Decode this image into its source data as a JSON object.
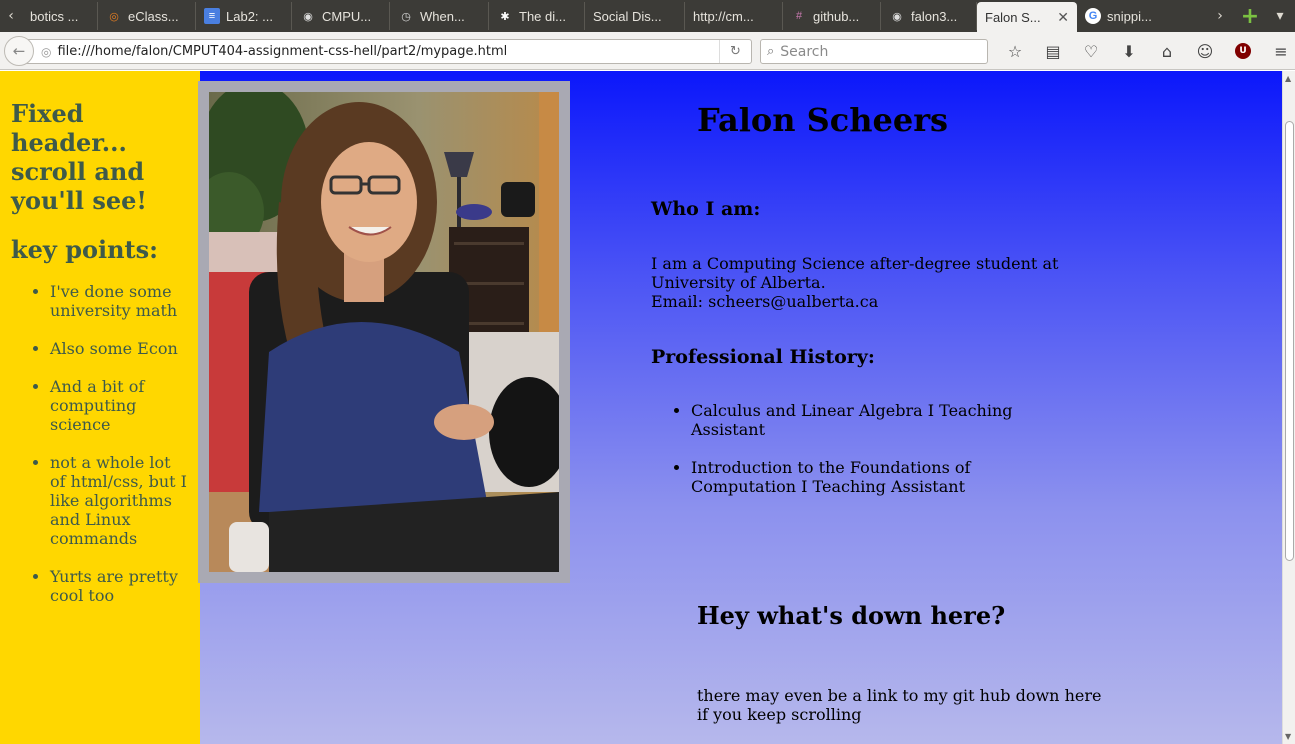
{
  "browser": {
    "tabs": [
      {
        "label": "botics ...",
        "icon": "doc-icon"
      },
      {
        "label": "eClass...",
        "icon": "eclass-icon"
      },
      {
        "label": "Lab2: ...",
        "icon": "google-docs-icon"
      },
      {
        "label": "CMPU...",
        "icon": "github-icon"
      },
      {
        "label": "When...",
        "icon": "clock-icon"
      },
      {
        "label": "The di...",
        "icon": "star-icon"
      },
      {
        "label": "Social Dis...",
        "icon": ""
      },
      {
        "label": "http://cm...",
        "icon": ""
      },
      {
        "label": "github...",
        "icon": "slack-icon"
      },
      {
        "label": "falon3...",
        "icon": "github-icon"
      },
      {
        "label": "Falon S...",
        "icon": "",
        "active": true
      },
      {
        "label": "snippi...",
        "icon": "google-icon"
      }
    ],
    "url": "file:///home/falon/CMPUT404-assignment-css-hell/part2/mypage.html",
    "search_placeholder": "Search",
    "ublock_badge": "U"
  },
  "sidebar": {
    "header": "Fixed header... scroll and you'll see!",
    "subheader": "key points:",
    "points": [
      "I've done some university math",
      "Also some Econ",
      "And a bit of computing science",
      "not a whole lot of html/css, but I like algorithms and Linux commands",
      "Yurts are pretty cool too"
    ]
  },
  "main": {
    "name": "Falon Scheers",
    "who_heading": "Who I am:",
    "who_line1": "I am a Computing Science after-degree student at University of Alberta.",
    "who_email": "Email: scheers@ualberta.ca",
    "prof_heading": "Professional History:",
    "prof_items": [
      "Calculus and Linear Algebra I Teaching Assistant",
      "Introduction to the Foundations of Computation I Teaching Assistant"
    ],
    "down_heading": "Hey what's down here?",
    "down_text": "there may even be a link to my git hub down here if you keep scrolling"
  },
  "colors": {
    "sidebar_bg": "#ffd700",
    "sidebar_text": "#3e5a4a",
    "gradient_top": "#0b17fb",
    "gradient_bottom": "#b6b8ec",
    "photo_frame": "#a9a9b3"
  }
}
